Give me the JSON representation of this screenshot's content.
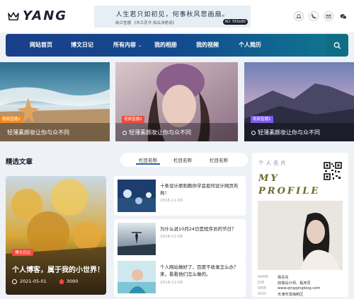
{
  "header": {
    "logo_text": "YANG",
    "banner_line1": "人生若只如初见，何事秋风悲画扇。",
    "banner_line2": "纳兰性德 《木兰花令·拟古决绝词》",
    "banner_badge": "AD: 550x80"
  },
  "nav": {
    "items": [
      "网站首页",
      "博文日记",
      "所有内容",
      "我的相册",
      "我的视频",
      "个人简历"
    ],
    "caret": "⌄"
  },
  "hero": [
    {
      "tag": "视频直播2",
      "title": "轻薄素颜妆让你与众不同",
      "tag_color": "#f28c1e"
    },
    {
      "tag": "视频直播2",
      "title": "轻薄素颜妆让你与众不同",
      "tag_color": "#f04b3a"
    },
    {
      "tag": "视频直播1",
      "title": "轻薄素颜妆让你与众不同",
      "tag_color": "#7b5be8"
    }
  ],
  "section": {
    "title": "精选文章",
    "tabs": [
      "栏目名称",
      "栏目名称",
      "栏目名称"
    ]
  },
  "feature": {
    "tag": "博文日记",
    "title": "个人博客，属于我的小世界！",
    "date": "2021-05-01",
    "views": "3090"
  },
  "articles": [
    {
      "title": "十条设计原则教你学会如何设计网页布局！",
      "date": "2018-11-08"
    },
    {
      "title": "为什么说10月24日是程序员的节日？",
      "date": "2018-11-08"
    },
    {
      "title": "个人网站做好了，百度不收录怎么办？来，看看他们怎么做的。",
      "date": "2018-11-08"
    }
  ],
  "profile": {
    "label": "个人名片",
    "heading_line1": "MY",
    "heading_line2": "PROFILE",
    "info": [
      {
        "key": "NAME",
        "value": "杨青青"
      },
      {
        "key": "JOB",
        "value": "前端设计师、程序员"
      },
      {
        "key": "WEB",
        "value": "www.qingqingblog.com"
      },
      {
        "key": "ADD",
        "value": "天津市滨海新区"
      }
    ]
  },
  "colors": {
    "nav_start": "#1a3f8a",
    "nav_end": "#0e7a91",
    "accent_red": "#f04b3a",
    "profile_heading": "#6b6a2a"
  },
  "icons": [
    "crown-icon",
    "bell-icon",
    "phone-icon",
    "mail-icon",
    "wechat-icon",
    "search-icon",
    "clock-icon",
    "fire-icon"
  ]
}
